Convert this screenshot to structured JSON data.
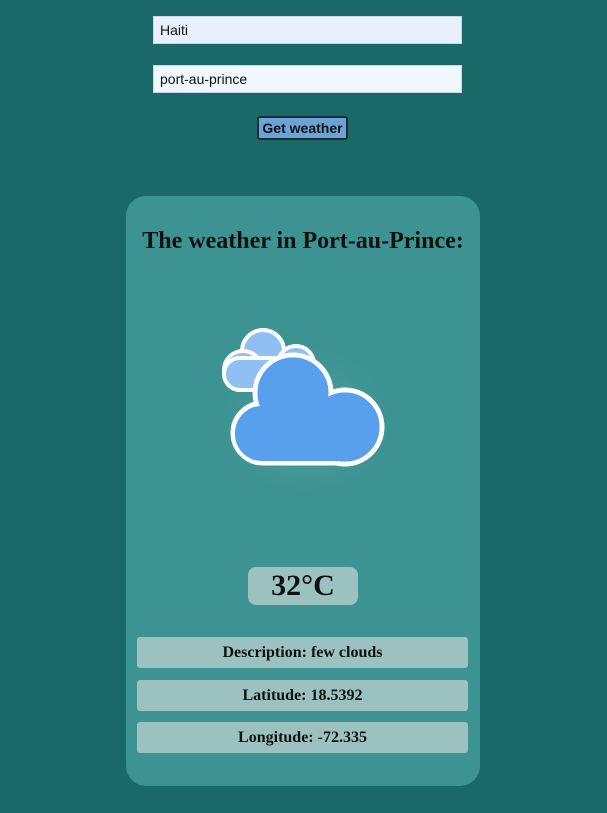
{
  "form": {
    "country_value": "Haiti",
    "city_value": "port-au-prince",
    "submit_label": "Get weather"
  },
  "result": {
    "title_prefix": "The weather in ",
    "city": "Port-au-Prince",
    "title_suffix": ":",
    "icon": "few-clouds-icon",
    "temperature": "32",
    "temperature_unit": "°C",
    "description_label": "Description: ",
    "description": "few clouds",
    "latitude_label": "Latitude: ",
    "latitude": "18.5392",
    "longitude_label": "Longitude: ",
    "longitude": "-72.335"
  },
  "colors": {
    "page_background": "#186968",
    "card_background": "#3c9392",
    "badge_background": "#9bc2c1",
    "button_background": "#6aa4d6",
    "cloud_front": "#58a0ec",
    "cloud_back": "#90bff3"
  }
}
